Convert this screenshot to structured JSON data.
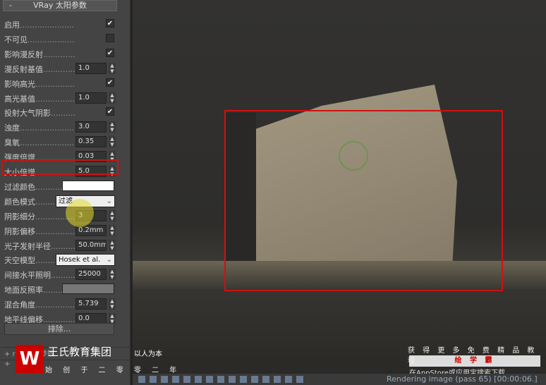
{
  "panel": {
    "title": "VRay 太阳参数",
    "collapse": "-",
    "exclude_button": "排除...",
    "rows": [
      {
        "label": "启用",
        "type": "check",
        "checked": true
      },
      {
        "label": "不可见",
        "type": "check",
        "checked": false
      },
      {
        "label": "影响漫反射",
        "type": "check",
        "checked": true
      },
      {
        "label": "漫反射基值",
        "type": "num",
        "value": "1.0"
      },
      {
        "label": "影响高光",
        "type": "check",
        "checked": true
      },
      {
        "label": "高光基值",
        "type": "num",
        "value": "1.0"
      },
      {
        "label": "投射大气阴影",
        "type": "check",
        "checked": true
      },
      {
        "label": "浊度",
        "type": "num",
        "value": "3.0"
      },
      {
        "label": "臭氧",
        "type": "num",
        "value": "0.35"
      },
      {
        "label": "强度倍增",
        "type": "num",
        "value": "0.03"
      },
      {
        "label": "大小倍增",
        "type": "num",
        "value": "5.0"
      },
      {
        "label": "过滤颜色",
        "type": "color",
        "value": "#ffffff"
      },
      {
        "label": "颜色模式",
        "type": "select",
        "value": "过滤"
      },
      {
        "label": "阴影细分",
        "type": "num",
        "value": "3"
      },
      {
        "label": "阴影偏移",
        "type": "num",
        "value": "0.2mm"
      },
      {
        "label": "光子发射半径",
        "type": "num",
        "value": "50.0mm"
      },
      {
        "label": "天空模型",
        "type": "select",
        "value": "Hosek et al."
      },
      {
        "label": "间接水平照明",
        "type": "num",
        "value": "25000"
      },
      {
        "label": "地面反照率",
        "type": "color",
        "value": "#777777"
      },
      {
        "label": "混合角度",
        "type": "num",
        "value": "5.739"
      },
      {
        "label": "地平线偏移",
        "type": "num",
        "value": "0.0"
      }
    ]
  },
  "side_rows": [
    "+  ray 自由参数",
    "+"
  ],
  "watermark": {
    "logo": "W",
    "brand": "王氏教育集团",
    "slogan": "以人为本",
    "slogan2": "始 创 于 二 零 零 二 年"
  },
  "promo": {
    "line1": "获 得 更 多 免 费 精 品 教 程",
    "brand": "绘 学 霸",
    "line2": "在AppStore或应用宝搜索下载"
  },
  "status": {
    "text": "Rendering image (pass 65) [00:00:06.]"
  }
}
